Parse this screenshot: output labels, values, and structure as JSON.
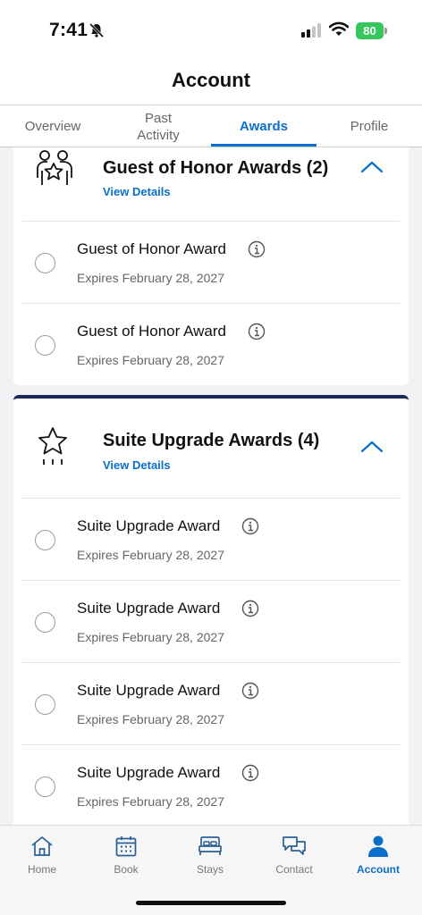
{
  "status_bar": {
    "time": "7:41",
    "battery": "80"
  },
  "header": {
    "title": "Account"
  },
  "tabs": [
    {
      "label": "Overview"
    },
    {
      "label": "Past Activity"
    },
    {
      "label": "Awards",
      "active": true
    },
    {
      "label": "Profile"
    }
  ],
  "sections": [
    {
      "title": "Guest of Honor Awards (2)",
      "view_details": "View Details",
      "icon": "people-star-icon",
      "awards": [
        {
          "name": "Guest of Honor Award",
          "expires": "Expires February 28, 2027"
        },
        {
          "name": "Guest of Honor Award",
          "expires": "Expires February 28, 2027"
        }
      ]
    },
    {
      "title": "Suite Upgrade Awards (4)",
      "view_details": "View Details",
      "icon": "star-upgrade-icon",
      "awards": [
        {
          "name": "Suite Upgrade Award",
          "expires": "Expires February 28, 2027"
        },
        {
          "name": "Suite Upgrade Award",
          "expires": "Expires February 28, 2027"
        },
        {
          "name": "Suite Upgrade Award",
          "expires": "Expires February 28, 2027"
        },
        {
          "name": "Suite Upgrade Award",
          "expires": "Expires February 28, 2027"
        }
      ]
    }
  ],
  "bottom_nav": [
    {
      "label": "Home",
      "icon": "home-icon"
    },
    {
      "label": "Book",
      "icon": "calendar-icon"
    },
    {
      "label": "Stays",
      "icon": "bed-icon"
    },
    {
      "label": "Contact",
      "icon": "chat-icon"
    },
    {
      "label": "Account",
      "icon": "person-icon",
      "active": true
    }
  ],
  "colors": {
    "accent": "#0a6fc9",
    "section_divider": "#1b2a5a",
    "battery": "#34c759"
  }
}
